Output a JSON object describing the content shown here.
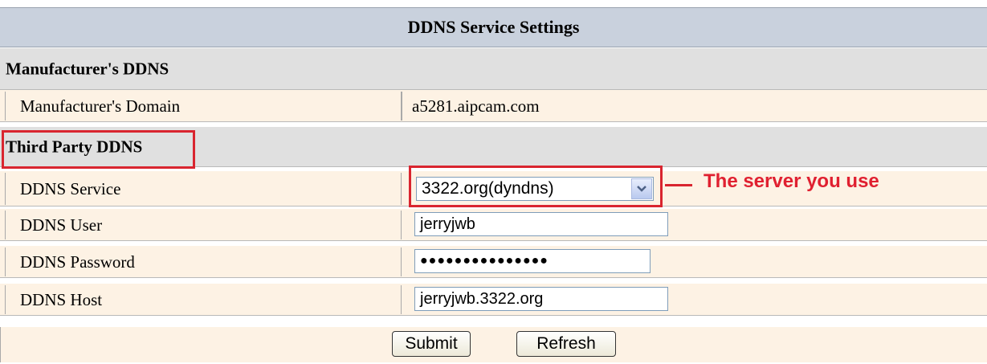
{
  "title": "DDNS Service Settings",
  "manufacturer_section": {
    "heading": "Manufacturer's DDNS",
    "domain_label": "Manufacturer's Domain",
    "domain_value": "a5281.aipcam.com"
  },
  "third_party_section": {
    "heading": "Third Party DDNS",
    "service_label": "DDNS Service",
    "service_value": "3322.org(dyndns)",
    "user_label": "DDNS User",
    "user_value": "jerryjwb",
    "password_label": "DDNS Password",
    "password_value": "●●●●●●●●●●●●●●●",
    "host_label": "DDNS Host",
    "host_value": "jerryjwb.3322.org"
  },
  "annotation": {
    "text": "The server you use",
    "color": "#e02030"
  },
  "buttons": {
    "submit_label": "Submit",
    "refresh_label": "Refresh"
  },
  "icons": {
    "select_arrow": "chevron-down-icon"
  },
  "colors": {
    "title_bg": "#c9d1dd",
    "section_bg": "#e0e0e0",
    "field_bg": "#fdf2e4",
    "highlight": "#d9252f"
  }
}
